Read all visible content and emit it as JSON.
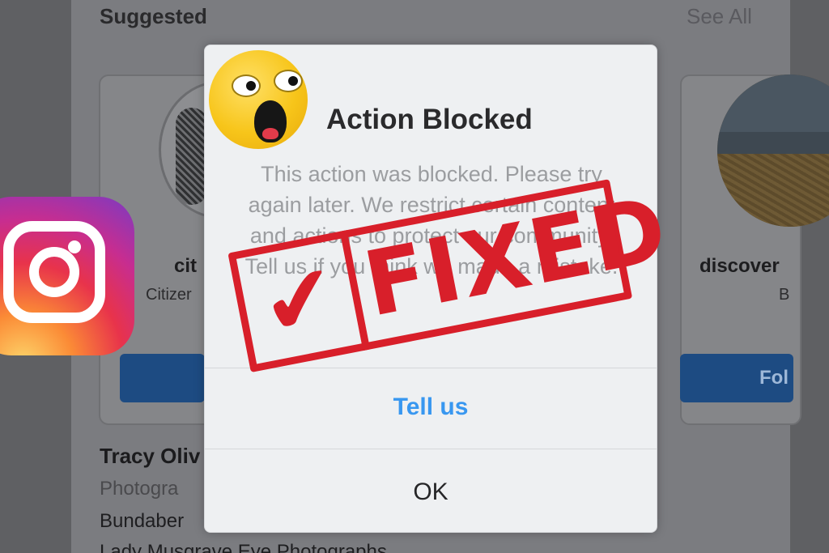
{
  "feed": {
    "suggested_title": "Suggested",
    "see_all": "See All",
    "cards": [
      {
        "name": "cit",
        "subtitle": "Citizer"
      },
      {
        "name": "discover",
        "subtitle": "B",
        "follow_label": "Fol"
      }
    ],
    "post": {
      "name": "Tracy Oliv",
      "role": "Photogra",
      "location": "Bundaber",
      "more": "Lady Musgrave Eye Photographs"
    }
  },
  "dialog": {
    "title": "Action Blocked",
    "body": "This action was blocked. Please try again later. We restrict certain content and actions to protect our community. Tell us if you think we made a mistake.",
    "tell_us_label": "Tell us",
    "ok_label": "OK"
  },
  "stamp": {
    "check": "✔",
    "text": "FIXED"
  },
  "colors": {
    "dialog_bg": "#eef0f2",
    "link_blue": "#3897f0",
    "stamp_red": "#d81f2a",
    "overlay_gray": "#6b6b6e"
  },
  "icons": {
    "logo": "instagram-logo",
    "emoji": "shocked-face-emoji"
  }
}
